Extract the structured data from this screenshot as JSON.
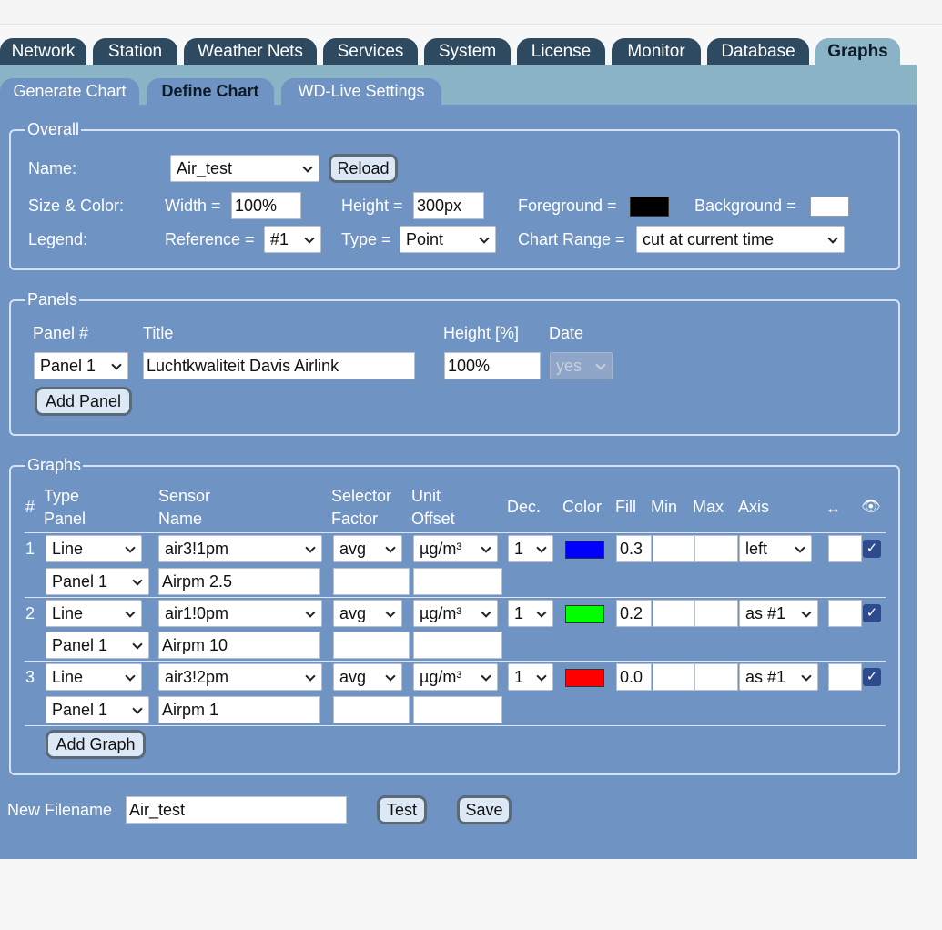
{
  "main_tabs": [
    "Network",
    "Station",
    "Weather Nets",
    "Services",
    "System",
    "License",
    "Monitor",
    "Database",
    "Graphs"
  ],
  "sub_tabs": [
    "Generate Chart",
    "Define Chart",
    "WD-Live Settings"
  ],
  "overall": {
    "legend": "Overall",
    "name_label": "Name:",
    "name_value": "Air_test",
    "reload_label": "Reload",
    "size_color_label": "Size & Color:",
    "width_label": "Width =",
    "width_value": "100%",
    "height_label": "Height =",
    "height_value": "300px",
    "foreground_label": "Foreground =",
    "foreground_color": "#000000",
    "background_label": "Background =",
    "background_color": "#ffffff",
    "legend_label": "Legend:",
    "reference_label": "Reference =",
    "reference_value": "#1",
    "type_label": "Type =",
    "type_value": "Point",
    "chart_range_label": "Chart Range =",
    "chart_range_value": "cut at current time"
  },
  "panels": {
    "legend": "Panels",
    "col_panel": "Panel #",
    "col_title": "Title",
    "col_height": "Height [%]",
    "col_date": "Date",
    "panel_value": "Panel 1",
    "title_value": "Luchtkwaliteit Davis Airlink",
    "height_value": "100%",
    "date_value": "yes",
    "add_panel_label": "Add Panel"
  },
  "graphs": {
    "legend": "Graphs",
    "headers": {
      "num": "#",
      "type_panel": [
        "Type",
        "Panel"
      ],
      "sensor_name": [
        "Sensor",
        "Name"
      ],
      "selector_factor": [
        "Selector",
        "Factor"
      ],
      "unit_offset": [
        "Unit",
        "Offset"
      ],
      "dec": "Dec.",
      "color": "Color",
      "fill": "Fill",
      "min": "Min",
      "max": "Max",
      "axis": "Axis",
      "width_icon": "↔",
      "visible_icon": "👁"
    },
    "rows": [
      {
        "num": "1",
        "type": "Line",
        "panel": "Panel 1",
        "sensor": "air3!1pm",
        "name": "Airpm 2.5",
        "selector": "avg",
        "factor": "",
        "unit": "µg/m³",
        "offset": "",
        "dec": "1",
        "color": "#0000ff",
        "fill": "0.3",
        "min": "",
        "max": "",
        "axis": "left",
        "line_width": "",
        "visible": true
      },
      {
        "num": "2",
        "type": "Line",
        "panel": "Panel 1",
        "sensor": "air1!0pm",
        "name": "Airpm 10",
        "selector": "avg",
        "factor": "",
        "unit": "µg/m³",
        "offset": "",
        "dec": "1",
        "color": "#00ff00",
        "fill": "0.2",
        "min": "",
        "max": "",
        "axis": "as #1",
        "line_width": "",
        "visible": true
      },
      {
        "num": "3",
        "type": "Line",
        "panel": "Panel 1",
        "sensor": "air3!2pm",
        "name": "Airpm 1",
        "selector": "avg",
        "factor": "",
        "unit": "µg/m³",
        "offset": "",
        "dec": "1",
        "color": "#ff0000",
        "fill": "0.0",
        "min": "",
        "max": "",
        "axis": "as #1",
        "line_width": "",
        "visible": true
      }
    ],
    "add_graph_label": "Add Graph"
  },
  "footer": {
    "new_filename_label": "New Filename",
    "new_filename_value": "Air_test",
    "test_label": "Test",
    "save_label": "Save"
  }
}
